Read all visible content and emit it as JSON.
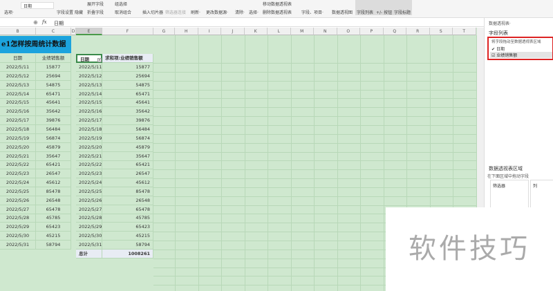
{
  "ribbon": {
    "options": "选项·",
    "field_name": "日期",
    "field_settings": "字段设置",
    "hide": "隐藏",
    "expand": "展开字段",
    "collapse": "折叠字段",
    "group_sel": "组选择",
    "ungroup": "取消组合",
    "insert_slicer": "插入切片器",
    "filter_conn": "筛选器连接",
    "refresh": "刷新·",
    "change_source": "更改数据源·",
    "clear": "清除·",
    "select": "选择·",
    "move_pivot": "移动数据透视表",
    "delete_pivot": "删除数据透视表",
    "fields_items": "字段、项目·",
    "pivot_chart": "数据透视图",
    "field_list": "字段列表",
    "buttons": "+/- 按钮",
    "field_headers": "字段标题"
  },
  "formula": {
    "fx": "fx",
    "value": "日期"
  },
  "columns": [
    "B",
    "C",
    "D",
    "E",
    "F",
    "G",
    "H",
    "I",
    "J",
    "K",
    "L",
    "M",
    "N",
    "O",
    "P",
    "Q",
    "R",
    "S",
    "T"
  ],
  "title": "e1怎样按周统计数据",
  "source": {
    "headers": [
      "日期",
      "业绩销售额"
    ]
  },
  "pivot": {
    "headers": [
      "日期",
      "求和项:业绩销售额"
    ],
    "total_label": "总计",
    "total": "1008261"
  },
  "rows": [
    [
      "2022/5/11",
      "15877"
    ],
    [
      "2022/5/12",
      "25694"
    ],
    [
      "2022/5/13",
      "54875"
    ],
    [
      "2022/5/14",
      "65471"
    ],
    [
      "2022/5/15",
      "45641"
    ],
    [
      "2022/5/16",
      "35642"
    ],
    [
      "2022/5/17",
      "39876"
    ],
    [
      "2022/5/18",
      "56484"
    ],
    [
      "2022/5/19",
      "56874"
    ],
    [
      "2022/5/20",
      "45879"
    ],
    [
      "2022/5/21",
      "35647"
    ],
    [
      "2022/5/22",
      "65421"
    ],
    [
      "2022/5/23",
      "26547"
    ],
    [
      "2022/5/24",
      "45612"
    ],
    [
      "2022/5/25",
      "85478"
    ],
    [
      "2022/5/26",
      "26548"
    ],
    [
      "2022/5/27",
      "65478"
    ],
    [
      "2022/5/28",
      "45785"
    ],
    [
      "2022/5/29",
      "65423"
    ],
    [
      "2022/5/30",
      "45215"
    ],
    [
      "2022/5/31",
      "58794"
    ]
  ],
  "panel": {
    "title": "数据透视表·",
    "field_list": "字段列表",
    "hint": "将字段拖动至数据透视表区域",
    "fields": [
      "日期",
      "业绩销售额"
    ],
    "areas_title": "数据透视表区域",
    "areas_hint": "在下面区域中拖动字段",
    "filter": "筛选器",
    "column": "列"
  },
  "watermark": "软件技巧"
}
